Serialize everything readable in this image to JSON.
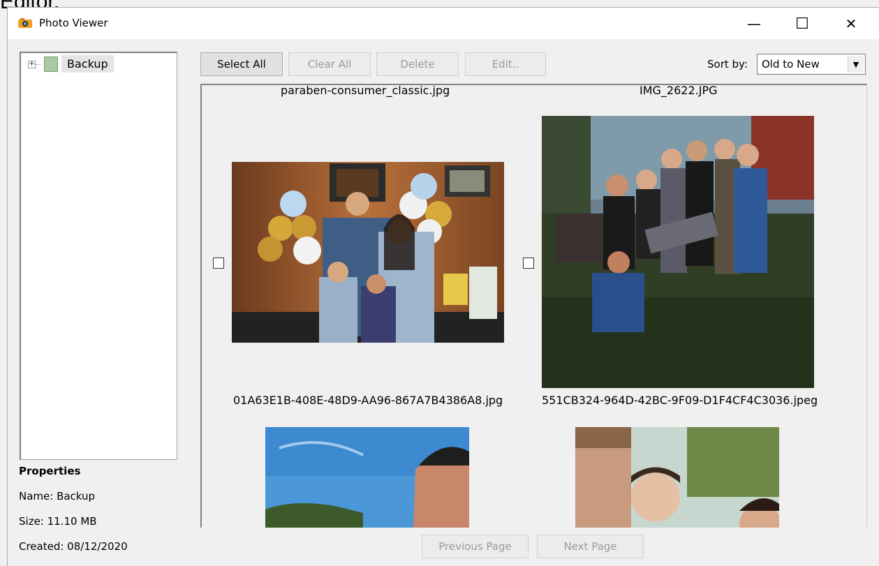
{
  "background_caption": "Editor.",
  "window": {
    "title": "Photo Viewer",
    "minimize": "—",
    "maximize": "☐",
    "close": "✕"
  },
  "tree": {
    "expander": "+",
    "root_label": "Backup"
  },
  "properties": {
    "heading": "Properties",
    "name": "Name:  Backup",
    "size": "Size:  11.10 MB",
    "created": "Created:  08/12/2020"
  },
  "toolbar": {
    "select_all": "Select All",
    "clear_all": "Clear All",
    "delete": "Delete",
    "edit": "Edit..",
    "sort_label": "Sort by:",
    "sort_value": "Old to New"
  },
  "gallery": {
    "top_captions": [
      "paraben-consumer_classic.jpg",
      "IMG_2622.JPG"
    ],
    "items": [
      {
        "caption": "01A63E1B-408E-48D9-AA96-867A7B4386A8.jpg",
        "checked": false
      },
      {
        "caption": "551CB324-964D-42BC-9F09-D1F4CF4C3036.jpeg",
        "checked": false
      }
    ]
  },
  "pager": {
    "prev": "Previous Page",
    "next": "Next Page"
  },
  "icons": {
    "app": "camera-icon",
    "scroll_up": "▲",
    "scroll_down": "▼",
    "sort_dropdown": "▼"
  }
}
